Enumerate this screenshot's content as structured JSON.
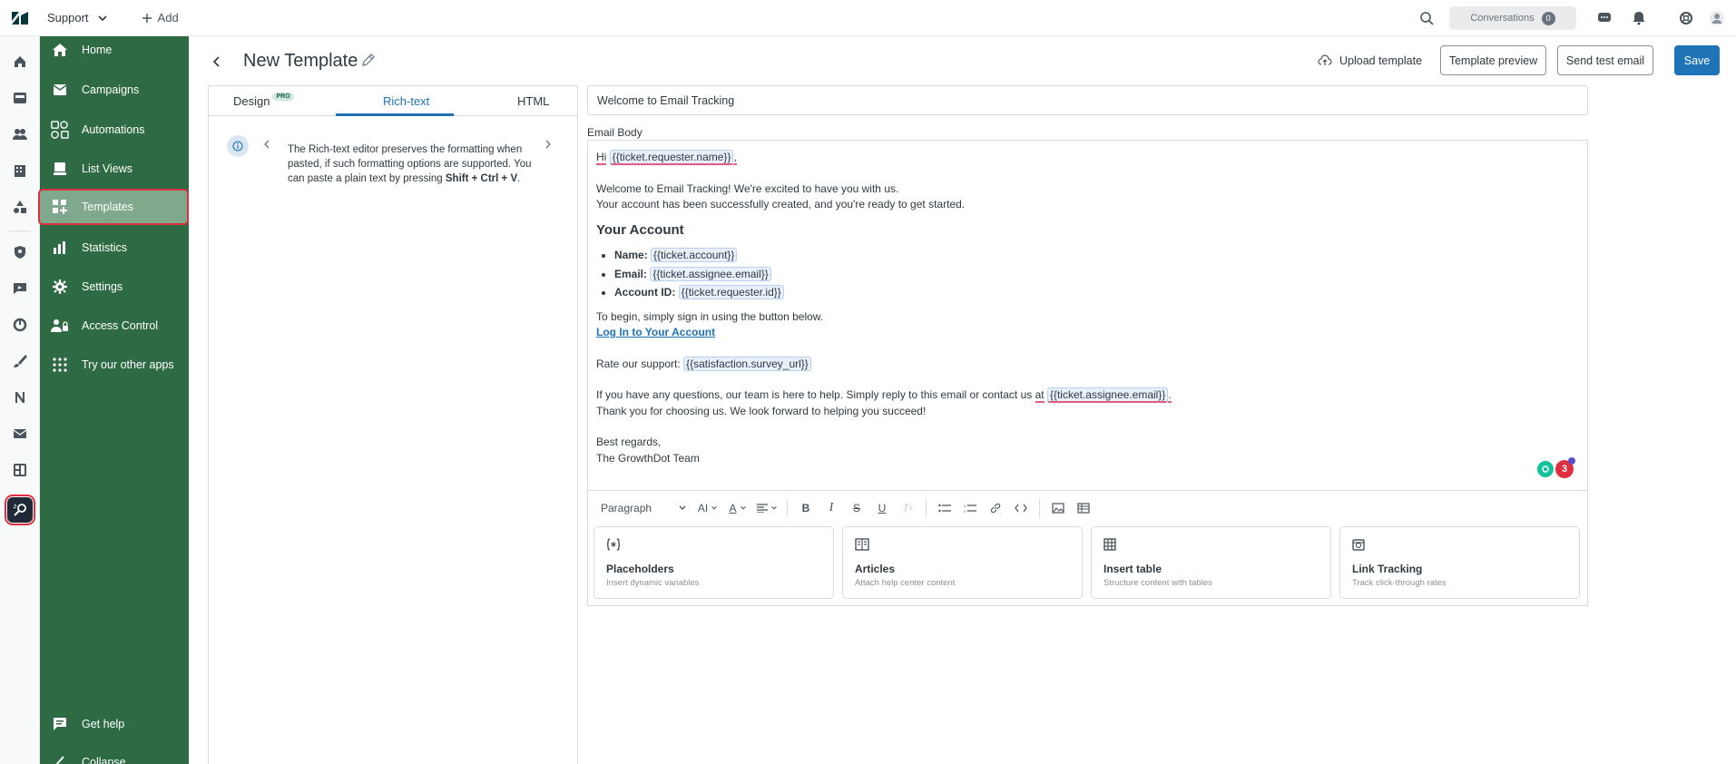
{
  "topbar": {
    "product": "Support",
    "add_label": "Add",
    "conversations_label": "Conversations",
    "conversations_count": "0"
  },
  "sidebar": {
    "items": [
      {
        "label": "Home",
        "icon": "home-icon"
      },
      {
        "label": "Campaigns",
        "icon": "mail-icon"
      },
      {
        "label": "Automations",
        "icon": "automations-icon"
      },
      {
        "label": "List Views",
        "icon": "list-views-icon"
      },
      {
        "label": "Templates",
        "icon": "templates-icon"
      },
      {
        "label": "Statistics",
        "icon": "bar-chart-icon"
      },
      {
        "label": "Settings",
        "icon": "gear-icon"
      },
      {
        "label": "Access Control",
        "icon": "access-control-icon"
      },
      {
        "label": "Try our other apps",
        "icon": "apps-grid-icon"
      }
    ],
    "get_help": "Get help",
    "collapse": "Collapse"
  },
  "header": {
    "title": "New Template",
    "upload": "Upload template",
    "preview": "Template preview",
    "send_test": "Send test email",
    "save": "Save"
  },
  "tabs": {
    "design": "Design",
    "pro": "PRO",
    "richtext": "Rich-text",
    "html": "HTML",
    "active": "Rich-text"
  },
  "info": {
    "text_before": "The Rich-text editor preserves the formatting when pasted, if such formatting options are supported. You can paste a plain text by pressing ",
    "shortcut": "Shift + Ctrl + V",
    "text_after": "."
  },
  "editor": {
    "subject": "Welcome to Email Tracking",
    "body_label": "Email Body",
    "hi": "Hi",
    "ph_requester_name": "{{ticket.requester.name}}",
    "comma": ",",
    "welcome_line1": "Welcome to Email Tracking! We're excited to have you with us.",
    "welcome_line2": "Your account has been successfully created, and you're ready to get started.",
    "heading": "Your Account",
    "list": [
      {
        "label": "Name:",
        "ph": "{{ticket.account}}"
      },
      {
        "label": "Email:",
        "ph": "{{ticket.assignee.email}}"
      },
      {
        "label": "Account ID:",
        "ph": "{{ticket.requester.id}}"
      }
    ],
    "begin": "To begin, simply sign in using the button below.",
    "login_link": "Log In to Your Account",
    "rate": "Rate our support:",
    "ph_survey": "{{satisfaction.survey_url}}",
    "questions_before": "If you have any questions, our team is here to help. Simply reply to this email or contact us ",
    "questions_at": "at",
    "ph_assignee": "{{ticket.assignee.email}}",
    "questions_end": ".",
    "thanks": "Thank you for choosing us. We look forward to helping you succeed!",
    "regards": "Best regards,",
    "team": "The GrowthDot Team",
    "grammarly_count": "3"
  },
  "toolbar": {
    "paragraph": "Paragraph",
    "ai": "AI",
    "font_color": "A"
  },
  "cards": [
    {
      "title": "Placeholders",
      "subtitle": "Insert dynamic variables",
      "icon": "placeholder-braces-icon"
    },
    {
      "title": "Articles",
      "subtitle": "Attach help center content",
      "icon": "book-icon"
    },
    {
      "title": "Insert table",
      "subtitle": "Structure content with tables",
      "icon": "table-icon"
    },
    {
      "title": "Link Tracking",
      "subtitle": "Track click-through rates",
      "icon": "link-tracking-icon"
    }
  ],
  "colors": {
    "sidebar_green": "#2e6b45",
    "accent_blue": "#1f73b7",
    "highlight_red": "#e02f3e"
  }
}
